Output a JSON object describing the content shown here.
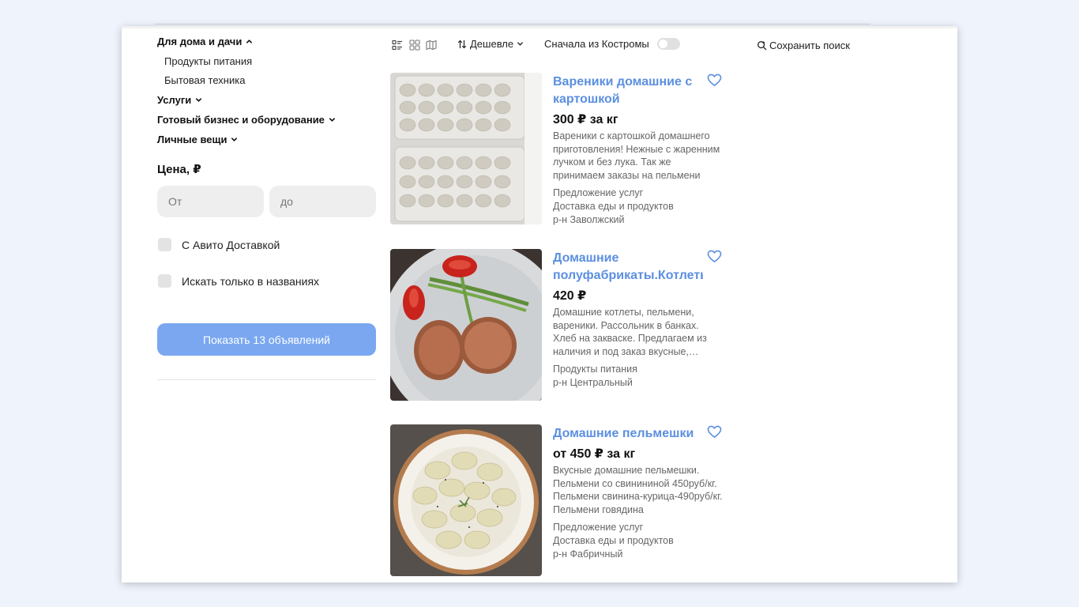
{
  "sidebar": {
    "categories": [
      {
        "label": "Для дома и дачи",
        "expanded": true,
        "children": [
          "Продукты питания",
          "Бытовая техника"
        ]
      },
      {
        "label": "Услуги",
        "expanded": false
      },
      {
        "label": "Готовый бизнес и оборудование",
        "expanded": false
      },
      {
        "label": "Личные вещи",
        "expanded": false
      }
    ],
    "price_title": "Цена, ₽",
    "price_from_placeholder": "От",
    "price_to_placeholder": "до",
    "checkbox_delivery": "С Авито Доставкой",
    "checkbox_titles_only": "Искать только в названиях",
    "show_button": "Показать 13 объявлений"
  },
  "toolbar": {
    "view_icons": [
      "list-view-icon",
      "grid-view-icon",
      "map-view-icon"
    ],
    "sort_label": "Дешевле",
    "kostroma_label": "Сначала из Костромы",
    "kostroma_toggle_on": false,
    "save_search": "Сохранить поиск"
  },
  "listings": [
    {
      "title": "Вареники домашние с картошкой",
      "price": "300 ₽ за кг",
      "description": "Вареники с картошкой домашнего приготовления! Нежные с жаренним лучком и без лука. Так же принимаем заказы на пельмени",
      "meta": [
        "Предложение услуг",
        "Доставка еды и продуктов",
        "р-н Заволжский"
      ]
    },
    {
      "title": "Домашние полуфабрикаты.Котлеты",
      "price": "420 ₽",
      "description": "Домашние котлеты, пельмени, вареники. Рассольник в банках. Хлеб на закваске. Предлагаем из наличия и под заказ вкусные, домашние",
      "meta": [
        "Продукты питания",
        "р-н Центральный"
      ]
    },
    {
      "title": "Домашние пельмешки",
      "price": "от 450 ₽ за кг",
      "description": "Вкусные домашние пельмешки. Пельмени со свинининой 450руб/кг. Пельмени свинина-курица-490руб/кг. Пельмени говядина",
      "meta": [
        "Предложение услуг",
        "Доставка еды и продуктов",
        "р-н Фабричный"
      ]
    }
  ],
  "colors": {
    "accent": "#5b8fe0",
    "button": "#7aa7f0",
    "background": "#eef3fc"
  }
}
